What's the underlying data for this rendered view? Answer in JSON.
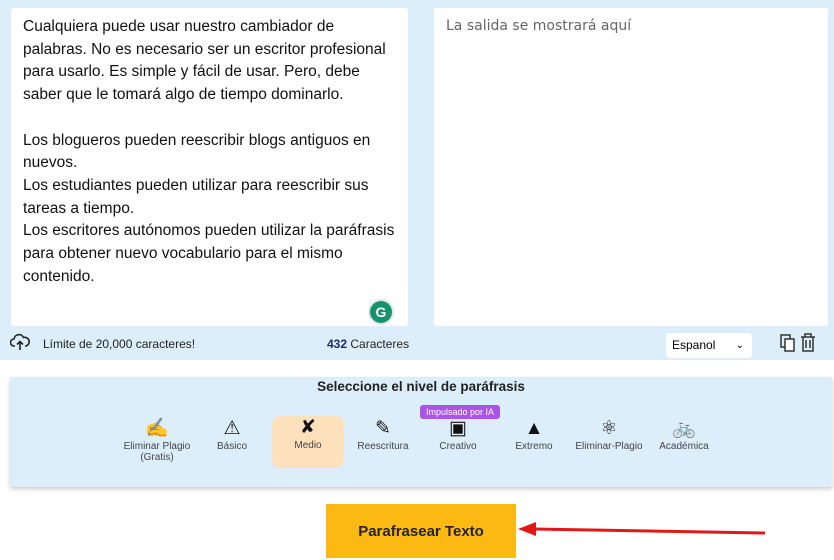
{
  "input": {
    "text": "Cualquiera puede usar nuestro cambiador de palabras. No es necesario ser un escritor profesional para usarlo. Es simple y fácil de usar. Pero, debe saber que le tomará algo de tiempo dominarlo.\n\nLos blogueros pueden reescribir blogs antiguos en nuevos.\nLos estudiantes pueden utilizar para reescribir sus tareas a tiempo.\nLos escritores autónomos pueden utilizar la paráfrasis para obtener nuevo vocabulario para el mismo contenido."
  },
  "output": {
    "placeholder": "La salida se mostrará aquí"
  },
  "footer": {
    "limit": "Límite de 20,000 caracteres!",
    "count": "432",
    "count_label": "Caracteres",
    "language": "Espanol"
  },
  "levels": {
    "title": "Seleccione el nivel de paráfrasis",
    "badge": "Impulsado por IA",
    "items": [
      {
        "label": "Eliminar Plagio",
        "sub": "(Gratis)",
        "icon": "✍"
      },
      {
        "label": "Básico",
        "icon": "⚠"
      },
      {
        "label": "Medio",
        "icon": "✘"
      },
      {
        "label": "Reescritura",
        "icon": "✎"
      },
      {
        "label": "Creativo",
        "icon": "▣"
      },
      {
        "label": "Extremo",
        "icon": "▲"
      },
      {
        "label": "Eliminar-Plagio",
        "icon": "⚛"
      },
      {
        "label": "Académica",
        "icon": "🚲"
      }
    ]
  },
  "action": {
    "label": "Parafrasear Texto"
  },
  "colors": {
    "accent": "#fdb913",
    "arrow": "#e01818",
    "badge": "#a855e8"
  }
}
